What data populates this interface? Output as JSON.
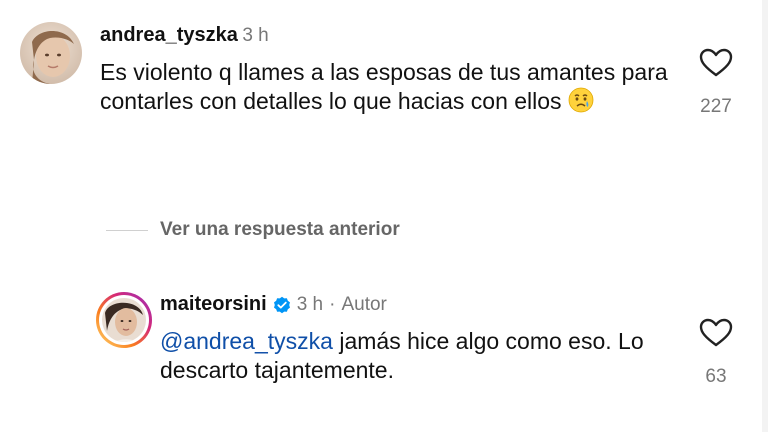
{
  "comments": [
    {
      "username": "andrea_tyszka",
      "time": "3 h",
      "text": "Es violento q llames a las esposas de tus amantes para contarles con detalles lo que hacias con ellos",
      "emoji": "crying-face",
      "likes": "227"
    },
    {
      "username": "maiteorsini",
      "time": "3 h",
      "separator": "·",
      "role": "Autor",
      "mention": "@andrea_tyszka",
      "text": " jamás hice algo como eso. Lo descarto tajantemente.",
      "likes": "63"
    }
  ],
  "replies_toggle": "Ver una respuesta anterior",
  "colors": {
    "mention": "#0f4fa8",
    "verified": "#0095f6",
    "meta": "#777777"
  }
}
